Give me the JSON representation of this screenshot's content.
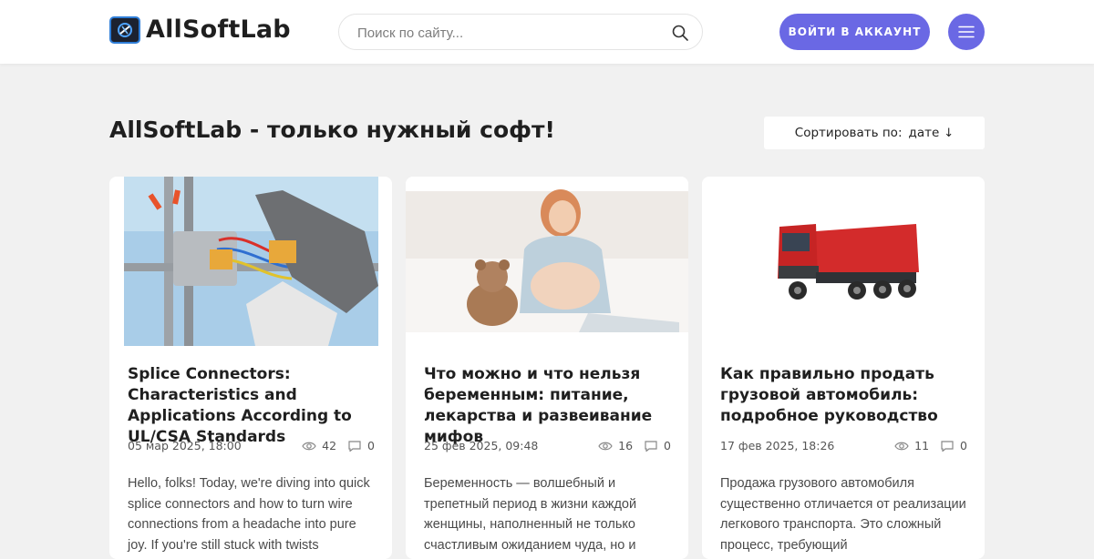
{
  "header": {
    "logo_text": "AllSoftLab",
    "search_placeholder": "Поиск по сайту...",
    "login_label": "ВОЙТИ В АККАУНТ",
    "accent_color": "#6a68e4"
  },
  "main": {
    "title": "AllSoftLab - только нужный софт!",
    "sort_label": "Сортировать по:",
    "sort_value": "дате",
    "sort_arrow": "↓"
  },
  "cards": [
    {
      "title": "Splice Connectors: Characteristics and Applications According to UL/CSA Standards",
      "date": "05 мар 2025, 18:00",
      "views": "42",
      "comments": "0",
      "excerpt": "Hello, folks! Today, we're diving into quick splice connectors and how to turn wire connections from a headache into pure joy. If you're still stuck with twists"
    },
    {
      "title": "Что можно и что нельзя беременным: питание, лекарства и развеивание мифов",
      "date": "25 фев 2025, 09:48",
      "views": "16",
      "comments": "0",
      "excerpt": "Беременность — волшебный и трепетный период в жизни каждой женщины, наполненный не только счастливым ожиданием чуда, но и"
    },
    {
      "title": "Как правильно продать грузовой автомобиль: подробное руководство",
      "date": "17 фев 2025, 18:26",
      "views": "11",
      "comments": "0",
      "excerpt": "Продажа грузового автомобиля существенно отличается от реализации легкового транспорта. Это сложный процесс, требующий"
    }
  ]
}
